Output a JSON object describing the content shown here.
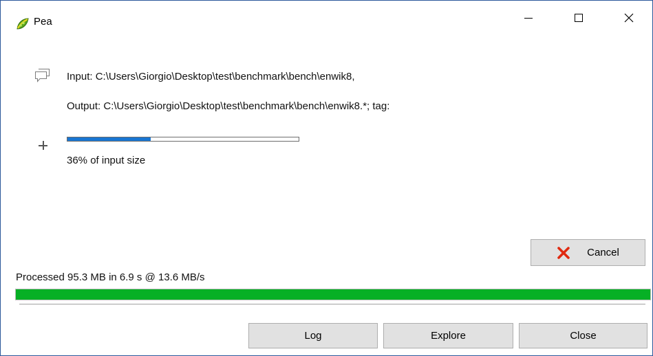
{
  "window": {
    "title": "Pea"
  },
  "content": {
    "input_line": "Input: C:\\Users\\Giorgio\\Desktop\\test\\benchmark\\bench\\enwik8,",
    "output_line": "Output: C:\\Users\\Giorgio\\Desktop\\test\\benchmark\\bench\\enwik8.*; tag:",
    "ratio_text": "36% of input size",
    "ratio_progress_percent": 36,
    "status_text": "Processed 95.3 MB in 6.9 s @ 13.6 MB/s",
    "main_progress_percent": 100
  },
  "buttons": {
    "cancel": "Cancel",
    "log": "Log",
    "explore": "Explore",
    "close": "Close"
  },
  "icons": {
    "app": "pea-pod-icon",
    "message": "speech-bubbles-icon",
    "expand": "plus-icon",
    "cancel": "red-x-icon"
  },
  "colors": {
    "ratio_bar": "#1976d2",
    "main_bar": "#06b025",
    "cancel_icon": "#e02a10"
  }
}
